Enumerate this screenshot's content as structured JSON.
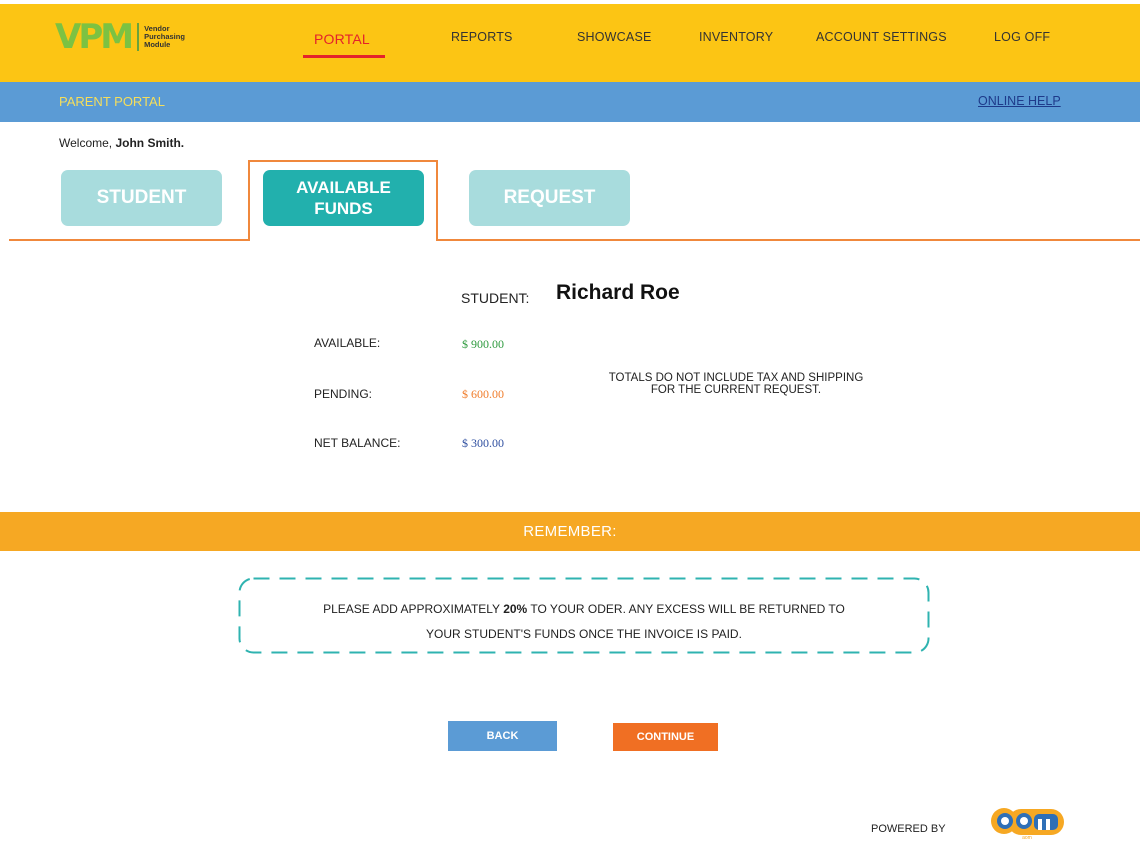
{
  "header": {
    "logo_mark": "VPM",
    "logo_text": "Vendor Purchasing Module",
    "nav": [
      {
        "label": "PORTAL",
        "active": true
      },
      {
        "label": "REPORTS",
        "active": false
      },
      {
        "label": "SHOWCASE",
        "active": false
      },
      {
        "label": "INVENTORY",
        "active": false
      },
      {
        "label": "ACCOUNT SETTINGS",
        "active": false
      },
      {
        "label": "LOG OFF",
        "active": false
      }
    ]
  },
  "subheader": {
    "title": "PARENT PORTAL",
    "help_link": "ONLINE HELP"
  },
  "welcome": {
    "prefix": "Welcome, ",
    "name": "John Smith."
  },
  "tabs": [
    {
      "label": "STUDENT",
      "active": false
    },
    {
      "label": "AVAILABLE FUNDS",
      "active": true
    },
    {
      "label": "REQUEST",
      "active": false
    }
  ],
  "student": {
    "label": "STUDENT:",
    "name": "Richard Roe"
  },
  "funds": {
    "available_label": "AVAILABLE:",
    "available_value": "$ 900.00",
    "pending_label": "PENDING:",
    "pending_value": "$ 600.00",
    "net_label": "NET BALANCE:",
    "net_value": "$ 300.00",
    "note": "TOTALS DO NOT INCLUDE TAX AND SHIPPING FOR THE CURRENT REQUEST."
  },
  "remember": {
    "title": "REMEMBER:",
    "line1_a": "PLEASE ADD APPROXIMATELY ",
    "line1_b": "20%",
    "line1_c": " TO YOUR ODER.  ANY EXCESS WILL BE RETURNED TO",
    "line2": "YOUR STUDENT'S FUNDS ONCE THE INVOICE IS PAID."
  },
  "buttons": {
    "back": "BACK",
    "continue": "CONTINUE"
  },
  "footer": {
    "powered_by": "POWERED BY",
    "logo": "aom"
  },
  "colors": {
    "header_yellow": "#fcc514",
    "subheader_blue": "#5b9bd5",
    "tab_teal": "#22b0ad",
    "tab_teal_light": "#a8dcdd",
    "remember_orange": "#f6a823",
    "continue_orange": "#f06f23",
    "available_green": "#2e9a3e",
    "pending_orange": "#f07c2a",
    "net_blue": "#2f4fa0"
  }
}
